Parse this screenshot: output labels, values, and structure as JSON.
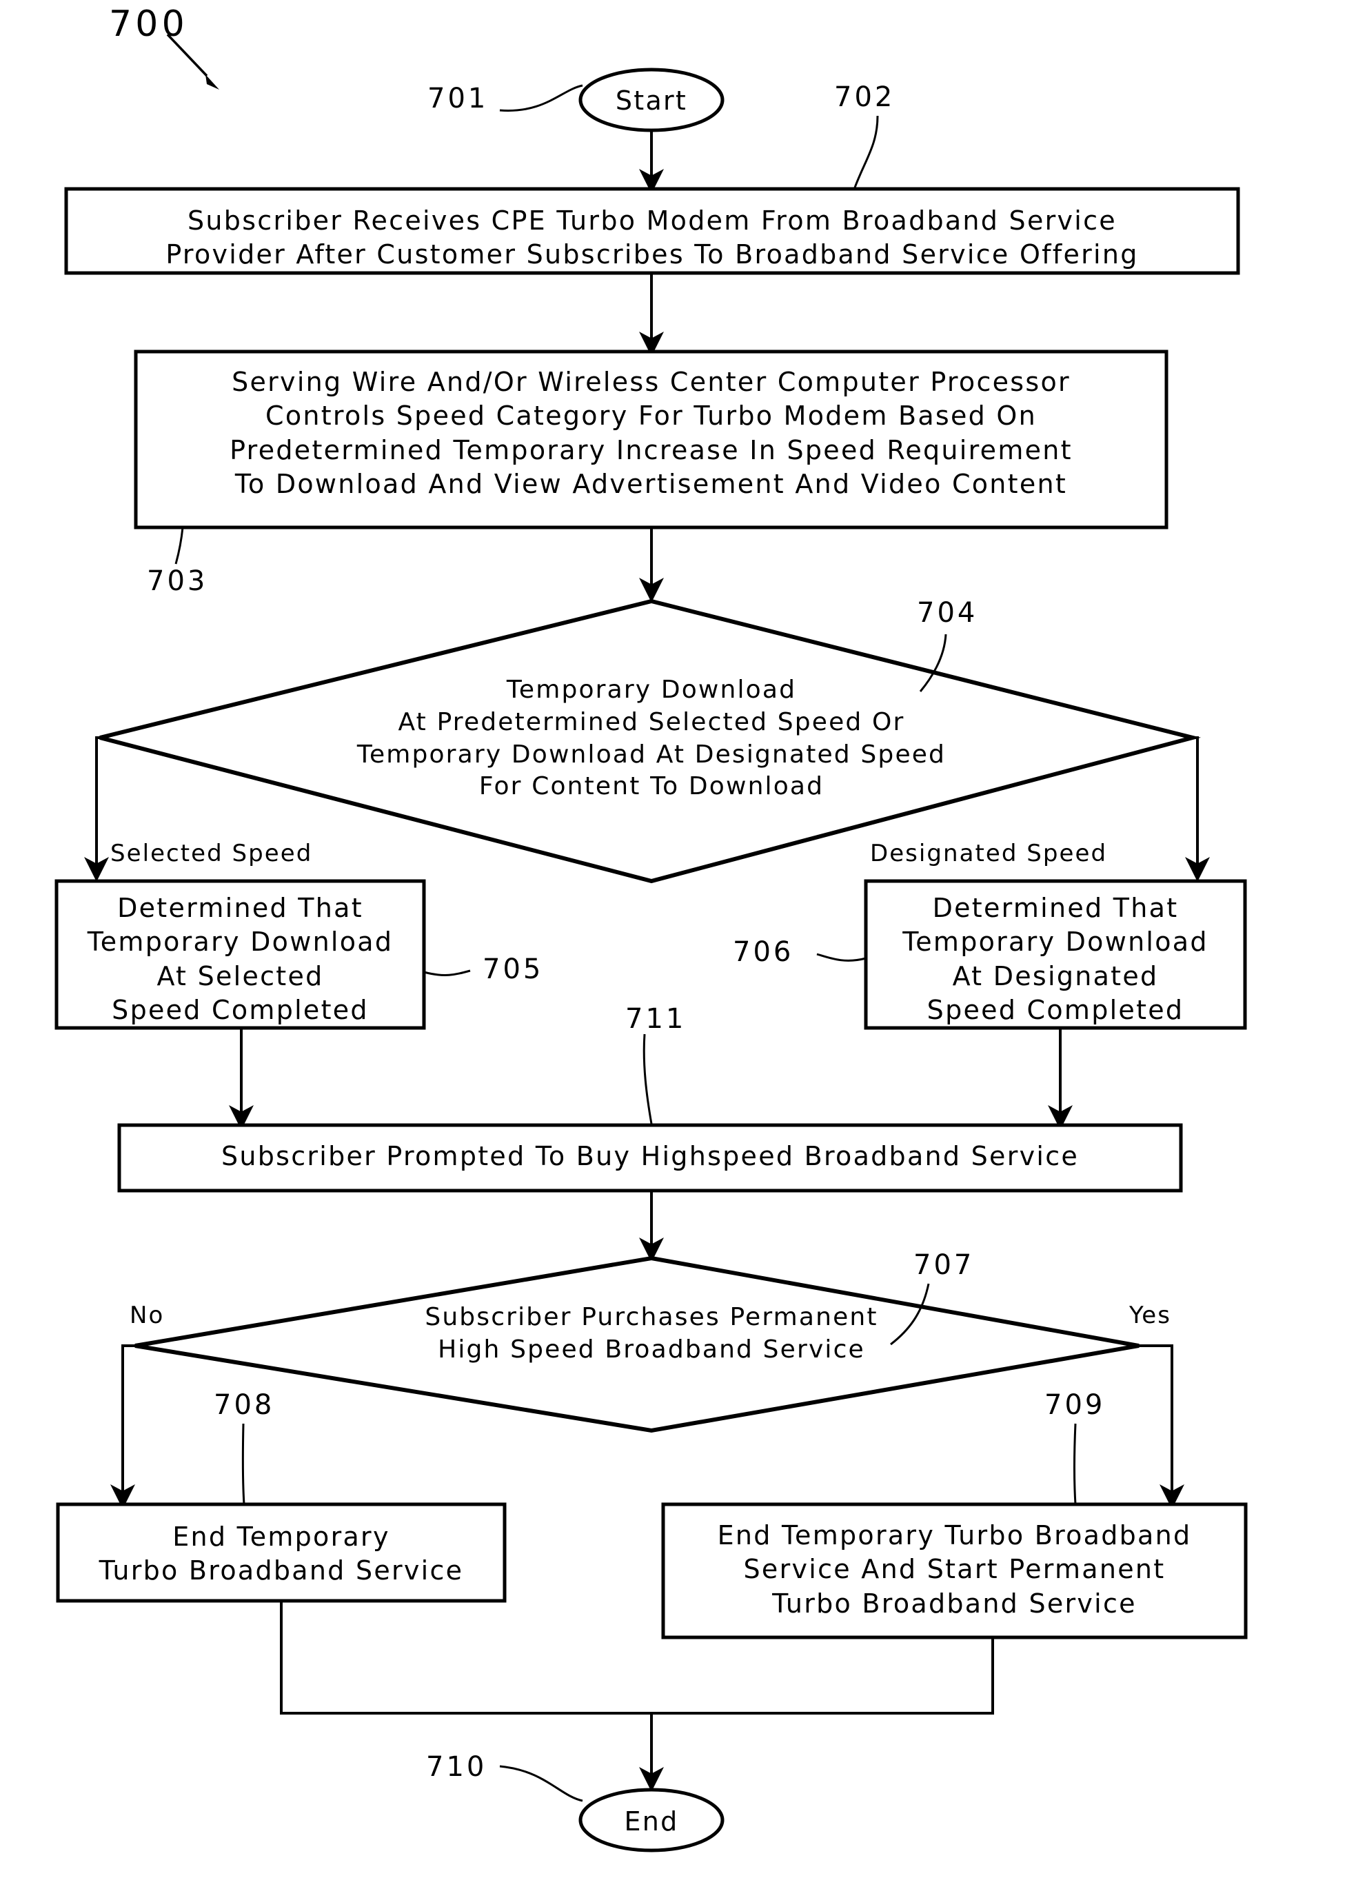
{
  "figure": {
    "number": "700",
    "type": "flowchart"
  },
  "nodes": {
    "start": {
      "ref": "701",
      "shape": "ellipse",
      "label": "Start"
    },
    "receive_modem": {
      "ref": "702",
      "shape": "process",
      "label": "Subscriber Receives CPE Turbo Modem From Broadband Service\nProvider After Customer Subscribes To Broadband Service Offering"
    },
    "speed_control": {
      "ref": "703",
      "shape": "process",
      "label": "Serving Wire And/Or Wireless Center Computer Processor\nControls Speed Category For Turbo Modem Based On\nPredetermined Temporary Increase In Speed Requirement\nTo Download And View Advertisement And Video Content"
    },
    "download_decision": {
      "ref": "704",
      "shape": "decision",
      "label": "Temporary Download\nAt Predetermined Selected Speed Or\nTemporary Download At Designated Speed\nFor Content To Download"
    },
    "selected_complete": {
      "ref": "705",
      "shape": "process",
      "label": "Determined That\nTemporary Download\nAt Selected\nSpeed Completed"
    },
    "designated_complete": {
      "ref": "706",
      "shape": "process",
      "label": "Determined That\nTemporary Download\nAt Designated\nSpeed Completed"
    },
    "prompt_buy": {
      "ref": "711",
      "shape": "process",
      "label": "Subscriber Prompted To Buy Highspeed Broadband Service"
    },
    "purchase_decision": {
      "ref": "707",
      "shape": "decision",
      "label": "Subscriber Purchases Permanent\nHigh Speed Broadband Service"
    },
    "end_temporary": {
      "ref": "708",
      "shape": "process",
      "label": "End Temporary\nTurbo Broadband Service"
    },
    "end_and_start_permanent": {
      "ref": "709",
      "shape": "process",
      "label": "End Temporary Turbo Broadband\nService And Start Permanent\nTurbo Broadband Service"
    },
    "end": {
      "ref": "710",
      "shape": "ellipse",
      "label": "End"
    }
  },
  "edge_labels": {
    "selected_speed": "Selected Speed",
    "designated_speed": "Designated Speed",
    "no": "No",
    "yes": "Yes"
  },
  "colors": {
    "stroke": "#000000",
    "fill": "#ffffff",
    "background": "#ffffff"
  }
}
